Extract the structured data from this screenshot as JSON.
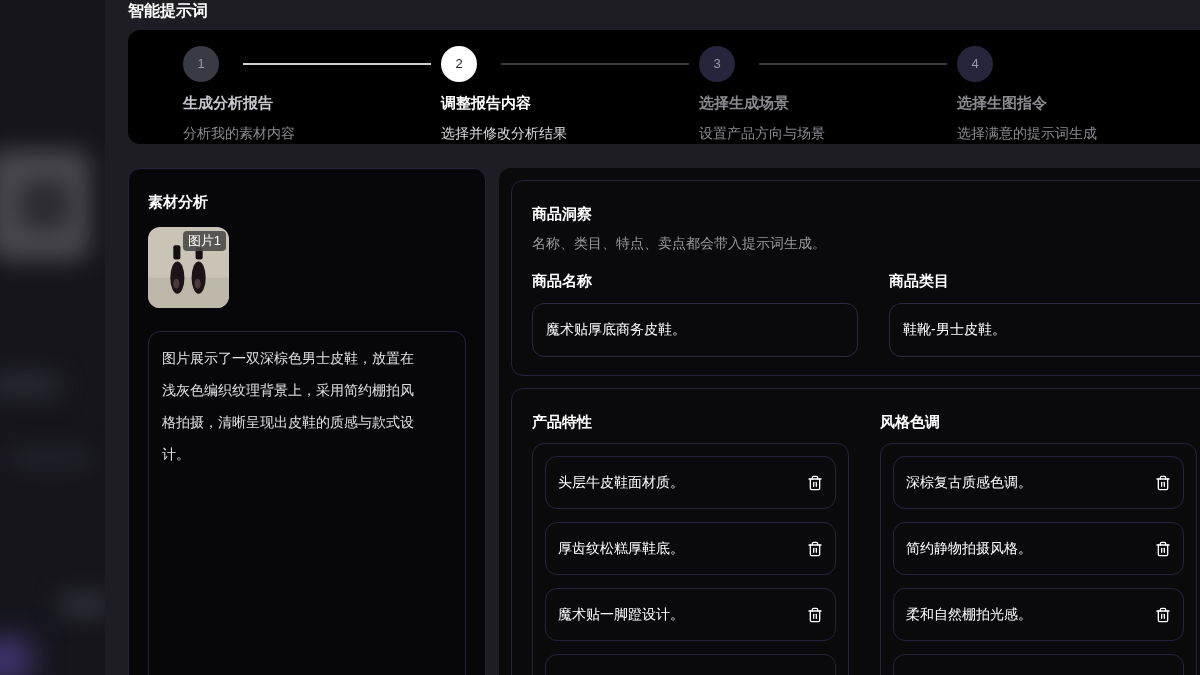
{
  "page_title": "智能提示词",
  "steps": [
    {
      "number": "1",
      "title": "生成分析报告",
      "subtitle": "分析我的素材内容",
      "completed": true,
      "selected": false
    },
    {
      "number": "2",
      "title": "调整报告内容",
      "subtitle": "选择并修改分析结果",
      "completed": false,
      "selected": true
    },
    {
      "number": "3",
      "title": "选择生成场景",
      "subtitle": "设置产品方向与场景",
      "completed": false,
      "selected": false
    },
    {
      "number": "4",
      "title": "选择生图指令",
      "subtitle": "选择满意的提示词生成",
      "completed": false,
      "selected": false
    }
  ],
  "material": {
    "title": "素材分析",
    "images": [
      {
        "kind": "picture",
        "badge": "图片1"
      }
    ],
    "description": "图片展示了一双深棕色男士皮鞋，放置在浅灰色编织纹理背景上，采用简约棚拍风格拍摄，清晰呈现出皮鞋的质感与款式设计。"
  },
  "insight": {
    "title": "商品洞察",
    "hint": "名称、类目、特点、卖点都会带入提示词生成。",
    "fields": [
      {
        "label": "商品名称",
        "value": "魔术贴厚底商务皮鞋。"
      },
      {
        "label": "商品类目",
        "value": "鞋靴-男士皮鞋。"
      }
    ]
  },
  "lists": [
    {
      "title": "产品特性",
      "items": [
        "头层牛皮鞋面材质。",
        "厚齿纹松糕厚鞋底。",
        "魔术贴一脚蹬设计。"
      ]
    },
    {
      "title": "风格色调",
      "items": [
        "深棕复古质感色调。",
        "简约静物拍摄风格。",
        "柔和自然棚拍光感。"
      ]
    }
  ]
}
